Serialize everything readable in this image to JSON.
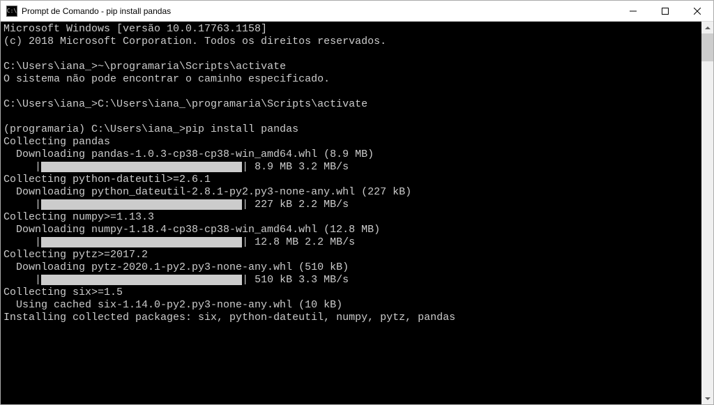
{
  "window": {
    "title": "Prompt de Comando - pip  install pandas",
    "icon_label": "C:\\"
  },
  "header": {
    "line1": "Microsoft Windows [versão 10.0.17763.1158]",
    "line2": "(c) 2018 Microsoft Corporation. Todos os direitos reservados."
  },
  "commands": {
    "cmd1_prompt": "C:\\Users\\iana_>",
    "cmd1_text": "~\\programaria\\Scripts\\activate",
    "cmd1_error": "O sistema não pode encontrar o caminho especificado.",
    "cmd2_prompt": "C:\\Users\\iana_>",
    "cmd2_text": "C:\\Users\\iana_\\programaria\\Scripts\\activate",
    "cmd3_prompt": "(programaria) C:\\Users\\iana_>",
    "cmd3_text": "pip install pandas"
  },
  "output": {
    "collect_pandas": "Collecting pandas",
    "dl_pandas": "Downloading pandas-1.0.3-cp38-cp38-win_amd64.whl (8.9 MB)",
    "pb_pandas_prefix": "     |",
    "pb_pandas_suffix": "| 8.9 MB 3.2 MB/s",
    "collect_dateutil": "Collecting python-dateutil>=2.6.1",
    "dl_dateutil": "Downloading python_dateutil-2.8.1-py2.py3-none-any.whl (227 kB)",
    "pb_dateutil_prefix": "     |",
    "pb_dateutil_suffix": "| 227 kB 2.2 MB/s",
    "collect_numpy": "Collecting numpy>=1.13.3",
    "dl_numpy": "Downloading numpy-1.18.4-cp38-cp38-win_amd64.whl (12.8 MB)",
    "pb_numpy_prefix": "     |",
    "pb_numpy_suffix": "| 12.8 MB 2.2 MB/s",
    "collect_pytz": "Collecting pytz>=2017.2",
    "dl_pytz": "Downloading pytz-2020.1-py2.py3-none-any.whl (510 kB)",
    "pb_pytz_prefix": "     |",
    "pb_pytz_suffix": "| 510 kB 3.3 MB/s",
    "collect_six": "Collecting six>=1.5",
    "cached_six": "Using cached six-1.14.0-py2.py3-none-any.whl (10 kB)",
    "installing": "Installing collected packages: six, python-dateutil, numpy, pytz, pandas"
  }
}
